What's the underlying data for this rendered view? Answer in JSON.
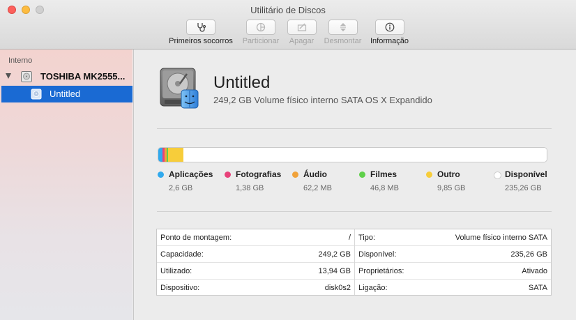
{
  "window": {
    "title": "Utilitário de Discos"
  },
  "toolbar": [
    {
      "label": "Primeiros socorros",
      "icon": "stethoscope-icon",
      "enabled": true
    },
    {
      "label": "Particionar",
      "icon": "partition-icon",
      "enabled": false
    },
    {
      "label": "Apagar",
      "icon": "erase-icon",
      "enabled": false
    },
    {
      "label": "Desmontar",
      "icon": "unmount-icon",
      "enabled": false
    },
    {
      "label": "Informação",
      "icon": "info-icon",
      "enabled": true
    }
  ],
  "sidebar": {
    "section": "Interno",
    "disk": {
      "name": "TOSHIBA MK2555..."
    },
    "volume": {
      "name": "Untitled"
    }
  },
  "volume": {
    "name": "Untitled",
    "subtitle": "249,2 GB Volume físico interno SATA OS X Expandido"
  },
  "usage": [
    {
      "name": "Aplicações",
      "value": "2,6 GB",
      "color": "#30a9ed",
      "fraction": 0.0104
    },
    {
      "name": "Fotografias",
      "value": "1,38 GB",
      "color": "#e8427a",
      "fraction": 0.0055
    },
    {
      "name": "Áudio",
      "value": "62,2 MB",
      "color": "#f0a23b",
      "fraction": 0.0003
    },
    {
      "name": "Filmes",
      "value": "46,8 MB",
      "color": "#5fd04a",
      "fraction": 0.0002
    },
    {
      "name": "Outro",
      "value": "9,85 GB",
      "color": "#f7cd3a",
      "fraction": 0.0395
    },
    {
      "name": "Disponível",
      "value": "235,26 GB",
      "color": "#ffffff",
      "fraction": 0.9441
    }
  ],
  "info_left": [
    {
      "key": "Ponto de montagem:",
      "value": "/"
    },
    {
      "key": "Capacidade:",
      "value": "249,2 GB"
    },
    {
      "key": "Utilizado:",
      "value": "13,94 GB"
    },
    {
      "key": "Dispositivo:",
      "value": "disk0s2"
    }
  ],
  "info_right": [
    {
      "key": "Tipo:",
      "value": "Volume físico interno SATA"
    },
    {
      "key": "Disponível:",
      "value": "235,26 GB"
    },
    {
      "key": "Proprietários:",
      "value": "Ativado"
    },
    {
      "key": "Ligação:",
      "value": "SATA"
    }
  ]
}
